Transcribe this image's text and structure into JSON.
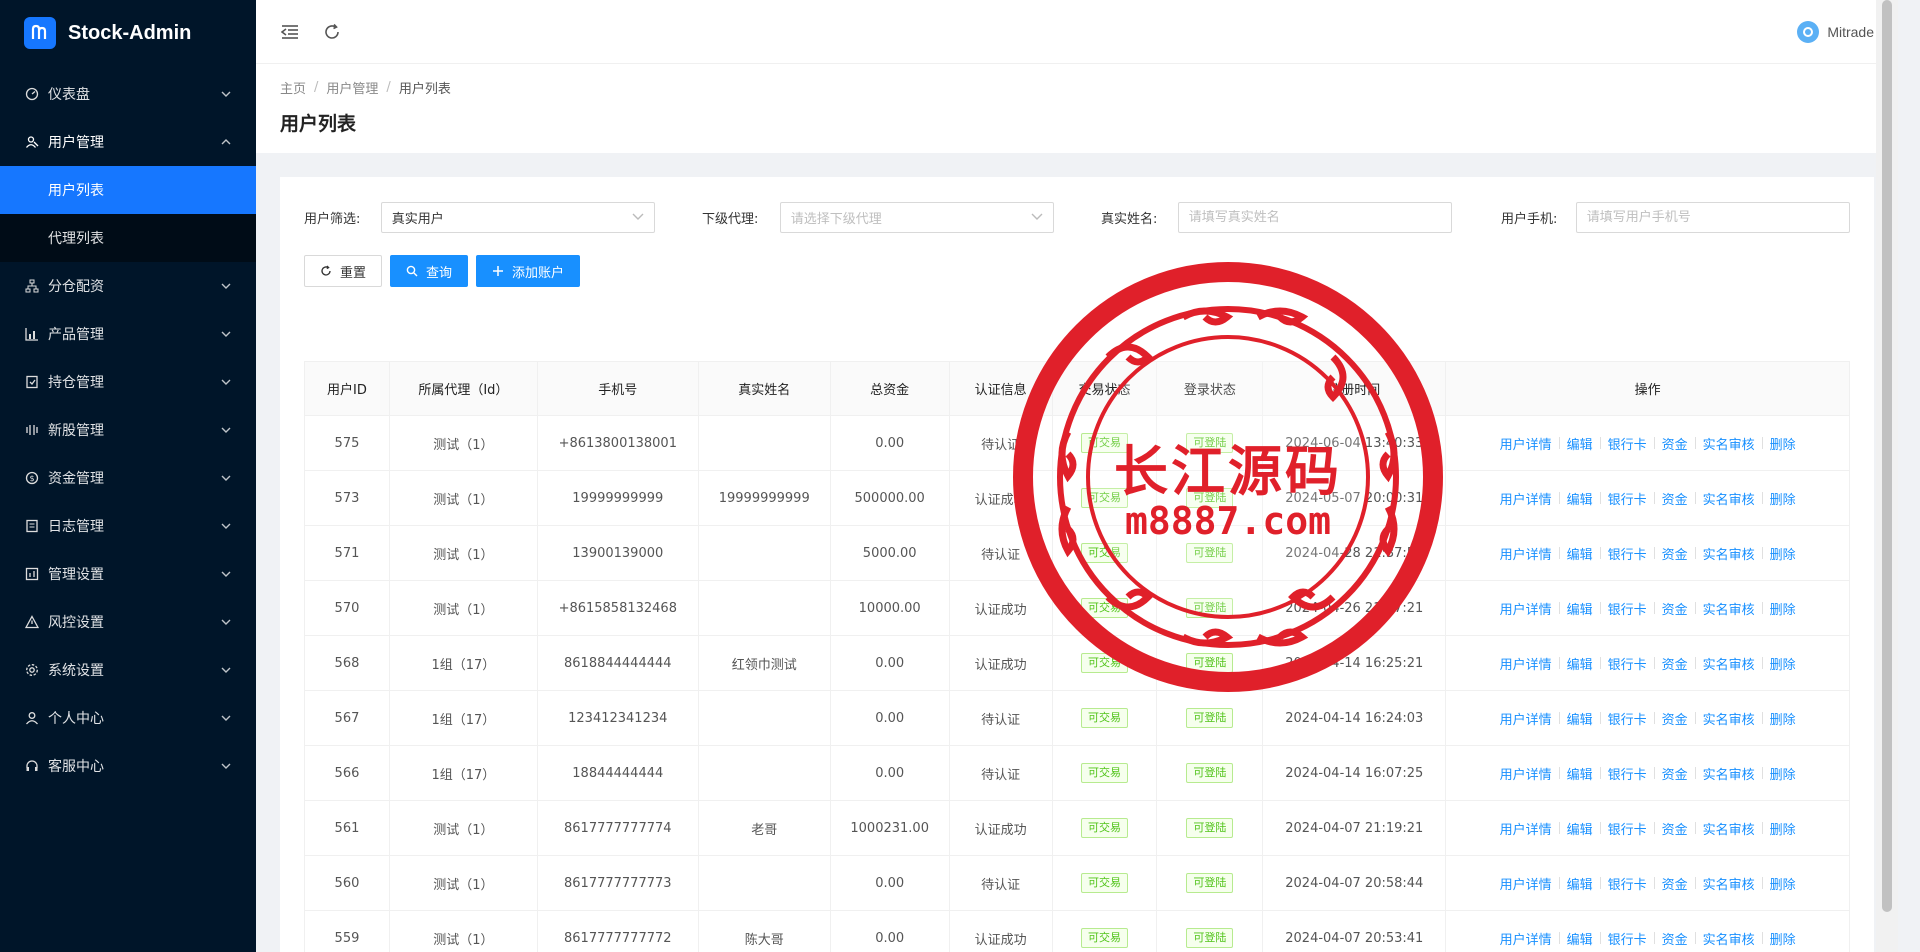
{
  "app": {
    "title": "Stock-Admin"
  },
  "sidebar": {
    "items": [
      {
        "label": "仪表盘",
        "icon": "dashboard-icon"
      },
      {
        "label": "用户管理",
        "icon": "user-manage-icon",
        "open": true,
        "children": [
          {
            "label": "用户列表",
            "active": true
          },
          {
            "label": "代理列表"
          }
        ]
      },
      {
        "label": "分仓配资",
        "icon": "network-icon"
      },
      {
        "label": "产品管理",
        "icon": "chart-icon"
      },
      {
        "label": "持仓管理",
        "icon": "position-icon"
      },
      {
        "label": "新股管理",
        "icon": "signal-icon"
      },
      {
        "label": "资金管理",
        "icon": "money-icon"
      },
      {
        "label": "日志管理",
        "icon": "log-icon"
      },
      {
        "label": "管理设置",
        "icon": "settings-chart-icon"
      },
      {
        "label": "风控设置",
        "icon": "warning-icon"
      },
      {
        "label": "系统设置",
        "icon": "gear-icon"
      },
      {
        "label": "个人中心",
        "icon": "person-icon"
      },
      {
        "label": "客服中心",
        "icon": "headset-icon"
      }
    ]
  },
  "topbar": {
    "user_name": "Mitrade"
  },
  "breadcrumb": [
    "主页",
    "用户管理",
    "用户列表"
  ],
  "page_title": "用户列表",
  "filters": {
    "user_filter": {
      "label": "用户筛选:",
      "value": "真实用户"
    },
    "sub_agent": {
      "label": "下级代理:",
      "placeholder": "请选择下级代理"
    },
    "real_name": {
      "label": "真实姓名:",
      "placeholder": "请填写真实姓名"
    },
    "phone": {
      "label": "用户手机:",
      "placeholder": "请填写用户手机号"
    }
  },
  "buttons": {
    "reset": "重置",
    "search": "查询",
    "add": "添加账户"
  },
  "table": {
    "headers": [
      "用户ID",
      "所属代理（Id）",
      "手机号",
      "真实姓名",
      "总资金",
      "认证信息",
      "交易状态",
      "登录状态",
      "注册时间",
      "操作"
    ],
    "ops": [
      "用户详情",
      "编辑",
      "银行卡",
      "资金",
      "实名审核",
      "删除"
    ],
    "rows": [
      {
        "id": "575",
        "agent": "测试（1）",
        "phone": "+8613800138001",
        "name": "",
        "funds": "0.00",
        "auth": "待认证",
        "trade": "可交易",
        "login": "可登陆",
        "time": "2024-06-04 13:40:33"
      },
      {
        "id": "573",
        "agent": "测试（1）",
        "phone": "19999999999",
        "name": "19999999999",
        "funds": "500000.00",
        "auth": "认证成功",
        "trade": "可交易",
        "login": "可登陆",
        "time": "2024-05-07 20:00:31"
      },
      {
        "id": "571",
        "agent": "测试（1）",
        "phone": "13900139000",
        "name": "",
        "funds": "5000.00",
        "auth": "待认证",
        "trade": "可交易",
        "login": "可登陆",
        "time": "2024-04-28 21:37:55"
      },
      {
        "id": "570",
        "agent": "测试（1）",
        "phone": "+8615858132468",
        "name": "",
        "funds": "10000.00",
        "auth": "认证成功",
        "trade": "可交易",
        "login": "可登陆",
        "time": "2024-04-26 21:17:21"
      },
      {
        "id": "568",
        "agent": "1组（17）",
        "phone": "8618844444444",
        "name": "红领巾测试",
        "funds": "0.00",
        "auth": "认证成功",
        "trade": "可交易",
        "login": "可登陆",
        "time": "2024-04-14 16:25:21"
      },
      {
        "id": "567",
        "agent": "1组（17）",
        "phone": "123412341234",
        "name": "",
        "funds": "0.00",
        "auth": "待认证",
        "trade": "可交易",
        "login": "可登陆",
        "time": "2024-04-14 16:24:03"
      },
      {
        "id": "566",
        "agent": "1组（17）",
        "phone": "18844444444",
        "name": "",
        "funds": "0.00",
        "auth": "待认证",
        "trade": "可交易",
        "login": "可登陆",
        "time": "2024-04-14 16:07:25"
      },
      {
        "id": "561",
        "agent": "测试（1）",
        "phone": "8617777777774",
        "name": "老哥",
        "funds": "1000231.00",
        "auth": "认证成功",
        "trade": "可交易",
        "login": "可登陆",
        "time": "2024-04-07 21:19:21"
      },
      {
        "id": "560",
        "agent": "测试（1）",
        "phone": "8617777777773",
        "name": "",
        "funds": "0.00",
        "auth": "待认证",
        "trade": "可交易",
        "login": "可登陆",
        "time": "2024-04-07 20:58:44"
      },
      {
        "id": "559",
        "agent": "测试（1）",
        "phone": "8617777777772",
        "name": "陈大哥",
        "funds": "0.00",
        "auth": "认证成功",
        "trade": "可交易",
        "login": "可登陆",
        "time": "2024-04-07 20:53:41"
      }
    ]
  },
  "watermark": {
    "line1": "长江源码",
    "line2": "m8887.com",
    "color": "#e0202a"
  },
  "colors": {
    "sidebar_bg": "#001529",
    "primary": "#1890ff",
    "active": "#1677ff",
    "success": "#52c41a"
  }
}
